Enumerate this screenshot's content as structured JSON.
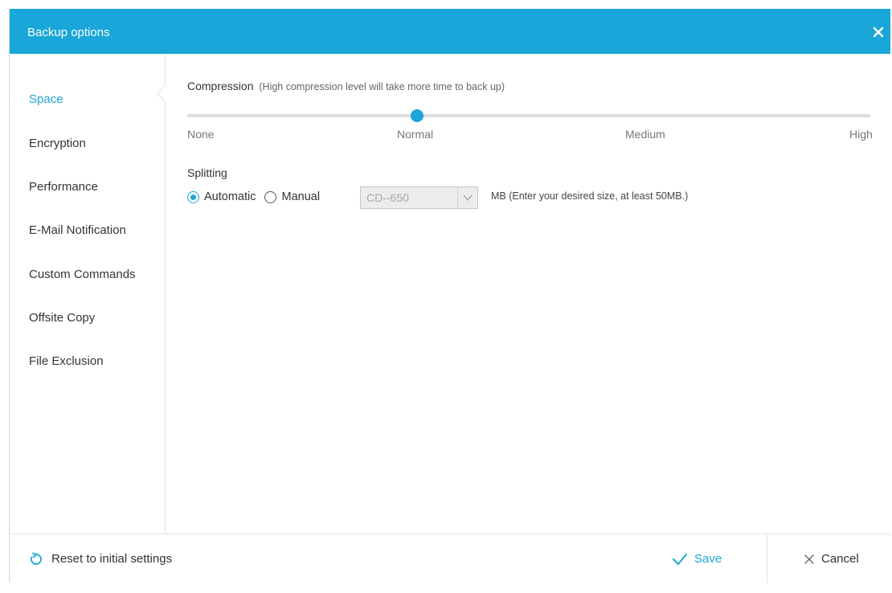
{
  "window": {
    "title": "Backup options",
    "accent_color": "#1aa6d8",
    "close_icon": "close-icon"
  },
  "sidebar": {
    "items": [
      {
        "label": "Space",
        "active": true
      },
      {
        "label": "Encryption"
      },
      {
        "label": "Performance"
      },
      {
        "label": "E-Mail Notification"
      },
      {
        "label": "Custom Commands"
      },
      {
        "label": "Offsite Copy"
      },
      {
        "label": "File Exclusion"
      }
    ]
  },
  "compression": {
    "label": "Compression",
    "hint": "(High compression level will take more time to back up)",
    "levels": [
      "None",
      "Normal",
      "Medium",
      "High"
    ],
    "selected": "Normal"
  },
  "splitting": {
    "label": "Splitting",
    "options": [
      "Automatic",
      "Manual"
    ],
    "selected": "Automatic",
    "size_select_value": "CD--650",
    "size_hint": "MB (Enter your desired size, at least 50MB.)"
  },
  "footer": {
    "reset_label": "Reset to initial settings",
    "save_label": "Save",
    "cancel_label": "Cancel"
  }
}
